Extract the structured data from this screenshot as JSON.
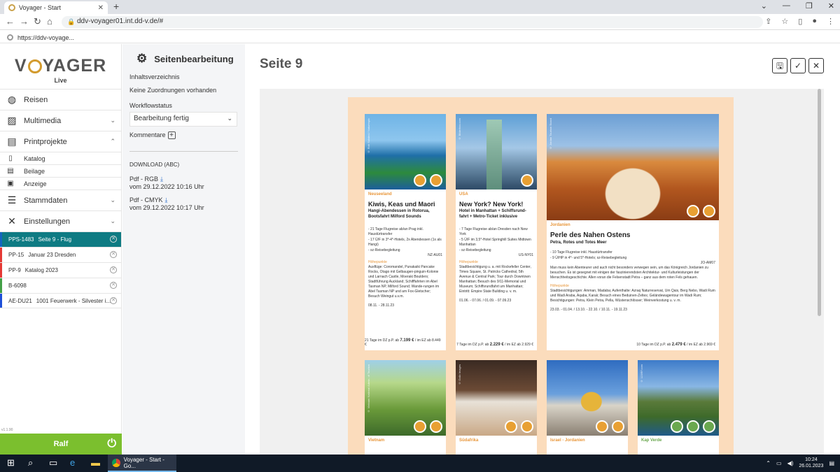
{
  "browser": {
    "tab_title": "Voyager - Start",
    "address": "ddv-voyager01.int.dd-v.de/#",
    "bookmark": "https://ddv-voyage..."
  },
  "sidebar": {
    "brand_left": "V",
    "brand_right": "YAGER",
    "brand_sub": "Live",
    "menu": [
      {
        "label": "Reisen",
        "icon": "globe-icon"
      },
      {
        "label": "Multimedia",
        "icon": "image-icon"
      },
      {
        "label": "Printprojekte",
        "icon": "book-icon"
      }
    ],
    "print_sub": [
      {
        "label": "Katalog",
        "icon": "catalog-icon"
      },
      {
        "label": "Beilage",
        "icon": "insert-icon"
      },
      {
        "label": "Anzeige",
        "icon": "ad-icon"
      }
    ],
    "menu2": [
      {
        "label": "Stammdaten",
        "icon": "database-icon"
      },
      {
        "label": "Einstellungen",
        "icon": "tools-icon"
      }
    ],
    "projects": [
      {
        "code": "PPS-1483",
        "name": "Seite 9 - Flug",
        "color": "#1565c0"
      },
      {
        "code": "PP-15",
        "name": "Januar 23 Dresden",
        "color": "#e53935"
      },
      {
        "code": "PP-9",
        "name": "Katalog 2023",
        "color": "#e53935"
      },
      {
        "code": "B-6098",
        "name": "",
        "color": "#43a047"
      },
      {
        "code": "AE-DU21",
        "name": "1001 Feuerwerk - Silvester i...",
        "color": "#1e4fd8"
      }
    ],
    "user": "Ralf",
    "version": "v1.1.90"
  },
  "panel": {
    "title": "Seitenbearbeitung",
    "toc": "Inhaltsverzeichnis",
    "no_assign": "Keine Zuordnungen vorhanden",
    "workflow_label": "Workflowstatus",
    "workflow_value": "Bearbeitung fertig",
    "comments": "Kommentare",
    "download": "DOWNLOAD (ABC)",
    "pdf_rgb": "Pdf - RGB",
    "pdf_rgb_date": "vom 29.12.2022 10:16 Uhr",
    "pdf_cmyk": "Pdf - CMYK",
    "pdf_cmyk_date": "vom 29.12.2022 10:17 Uhr"
  },
  "main": {
    "title": "Seite 9"
  },
  "cards": [
    {
      "region": "Neuseeland",
      "title": "Kiwis, Keas und Maori",
      "sub": "Hangi-Abendessen in Rotorua, Bootsfahrt Milford Sounds",
      "bullets": [
        "21 Tage Flugreise ab/an Prag inkl. Haustürtransfer",
        "17 Ü/F in 3*-4*-Hotels, 2x Abendessen (1x als Hangi)",
        "sz-Reisebegleitung"
      ],
      "code": "NZ-AU01",
      "hl": "Höhepunkte",
      "text": "Ausflüge: Coromandel, Punakaiki Pancake Rocks, Otago mit Gelbaugen-pinguin-Kolonie und Larnach Castle, Moeraki Boulders; Stadtführung Auckland; Schifffahrten im Abel Tasman NP, Milford Sound; Wande-rungen im Abel Tasman NP und am Fox-Gletscher; Besuch Weingut u.v.m.",
      "dates": "08.11. - 28.11.23",
      "price_pre": "21 Tage im DZ p.P. ab ",
      "price": "7.199 €",
      "price_post": " / im EZ ab 8.449 €",
      "credit": "© Rob Suisted / Naturespic"
    },
    {
      "region": "USA",
      "title": "New York? New York!",
      "sub": "Hotel in Manhattan + Schiffsrund-fahrt + Metro-Ticket inklusive",
      "bullets": [
        "7 Tage Flugreise ab/an Dresden nach New York",
        "5 Ü/F im 3,5*-Hotel Springhill Suites Midtown Manhattan",
        "sz-Reisebegleitung"
      ],
      "code": "US-NY01",
      "hl": "Höhepunkte",
      "text": "Stadtbesichtigung u. a. mit Rockefeller Center, Times Square, St. Patricks Cathedral, 5th Avenue & Central Park; Tour durch Downtown Manhattan; Besuch des 9/11-Memorial und Museum; Schiffsrundfahrt um Manhattan; Eintritt: Empire State Building u. v. m.",
      "dates": "01.06. - 07.06. / 01.09. - 07.09.23",
      "price_pre": "7 Tage im DZ p.P. ab ",
      "price": "2.229 €",
      "price_post": " / im EZ ab 2.929 €",
      "credit": "© Bilderbox.com"
    },
    {
      "region": "Jordanien",
      "title": "Perle des Nahen Ostens",
      "sub": "Petra, Rotes und Totes Meer",
      "bullets": [
        "10 Tage Flugreise inkl. Haustürtransfer",
        "9 Ü/HP in 4*- und 5*-Hotels; sz-Reisebegleitung"
      ],
      "code": "JO-AM07",
      "intro": "Man muss kein Abenteurer und auch nicht besonders verwegen sein, um das Königreich Jordanien zu besuchen. Es ist gesegnet mit einigen der faszinierendsten Architektur- und Kulturleistungen der Menschheitsgeschichte. Allen voran die Felsenstadt Petra – ganz aus dem roten Fels gehauen.",
      "hl": "Höhepunkte",
      "text": "Stadtbesichtigungen: Amman, Madaba; Aufenthalte: Azraq Naturreservat, Um Qais, Berg Nebo, Wadi Rum und Wadi Araba, Aqaba, Karak; Besuch eines Beduinen-Zeltes; Geländewagentour im Wadi Rum; Besichtigungen: Petra, Klein Petra, Pella, Wüstenschlösser; Weinverkostung u. v. m.",
      "dates": "23.03. - 01.04. / 13.10. - 22.10. / 10.11. - 19.11.23",
      "price_pre": "10 Tage im DZ p.P. ab ",
      "price": "2.479 €",
      "price_post": " / im EZ ab 2.969 €",
      "credit": "© Jordan Tourism Board"
    }
  ],
  "bottom_cards": [
    {
      "region": "Vietnam",
      "credit": "© Vietnam National Admin. of Tourism"
    },
    {
      "region": "Südafrika",
      "credit": "© Gallo Images"
    },
    {
      "region": "Israel - Jordanien",
      "credit": ""
    },
    {
      "region": "Kap Verde",
      "credit": "© 123RF.com"
    }
  ],
  "taskbar": {
    "app": "Voyager - Start - Go...",
    "time": "10:24",
    "date": "26.01.2023"
  }
}
